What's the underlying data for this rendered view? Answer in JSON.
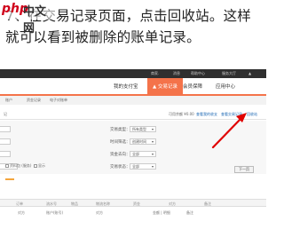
{
  "logo": {
    "php": "php",
    "cn": "中文网"
  },
  "instruction": {
    "line1": "7、在交易记录页面，点击回收站。这样",
    "line2": "就可以看到被删除的账单记录。"
  },
  "topbar": {
    "items": [
      "商家.",
      "消息",
      "帮助中心",
      "服务大厅",
      "▲"
    ]
  },
  "mainnav": {
    "items": [
      "我的支付宝",
      "交易记录",
      "会员保障",
      "应用中心"
    ],
    "active_index": 1
  },
  "subnav": {
    "items": [
      "账户",
      "资金记录",
      "电子对账单"
    ]
  },
  "toolbar": {
    "left": "记",
    "right_text": "可用余额 ¥0.00",
    "items": [
      "查看我的收支",
      "查看交易记录"
    ],
    "recycle_label": "回收站"
  },
  "filter": {
    "labels": [
      "交易类型：",
      "时间筛选：",
      "资金去向：",
      "交易状态："
    ],
    "values": [
      "所有类型",
      "创建时间",
      "全部",
      "全部"
    ],
    "checkboxes": [
      "资料包 (服务)",
      "显示"
    ]
  },
  "next_button": "下一页",
  "table": {
    "headers": [
      "订单",
      "流水号",
      "物品",
      "物流名称",
      "资金",
      "对方",
      "备注"
    ],
    "subheaders": [
      "对方",
      "账户(账号)",
      "对方",
      "金额 | 明细",
      "备注"
    ]
  },
  "colors": {
    "accent": "#f4734a",
    "arrow": "#e00000"
  }
}
